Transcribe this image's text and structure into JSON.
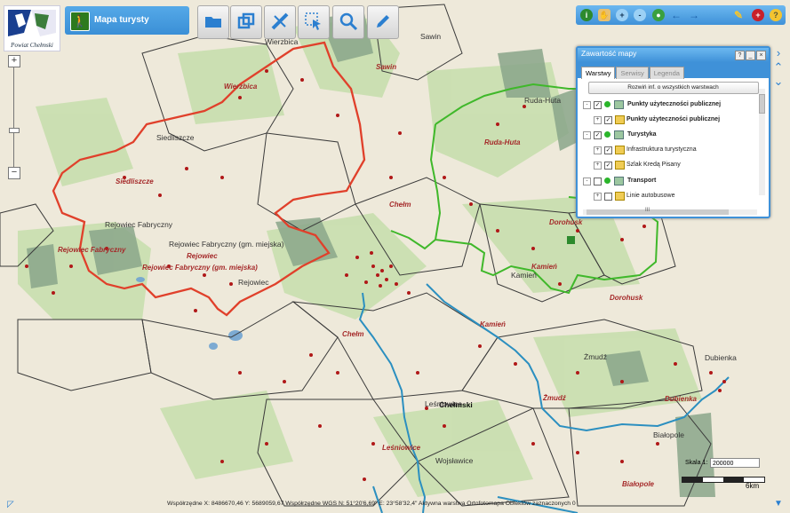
{
  "logo": {
    "text": "Powiat Chełmski"
  },
  "title": "Mapa turysty",
  "toolbar": {
    "icons": [
      "folder-icon",
      "windows-icon",
      "measure-icon",
      "select-icon",
      "search-icon",
      "edit-icon"
    ]
  },
  "right_toolbar": {
    "icons": [
      "info-icon",
      "hand-icon",
      "zoom-in-icon",
      "zoom-out-icon",
      "globe-icon",
      "back-icon",
      "forward-icon",
      "help-tools-icon",
      "flag-icon",
      "question-icon"
    ]
  },
  "panel": {
    "title": "Zawartość mapy",
    "tabs": [
      "Warstwy",
      "Serwisy",
      "Legenda"
    ],
    "active_tab": "Warstwy",
    "expand_button": "Rozwiń inf. o wszystkich warstwach",
    "layers": [
      {
        "label": "Punkty użyteczności publicznej",
        "level": 0,
        "bold": true
      },
      {
        "label": "Punkty użyteczności publicznej",
        "level": 1,
        "bold": true
      },
      {
        "label": "Turystyka",
        "level": 0,
        "bold": true
      },
      {
        "label": "Infrastruktura turystyczna",
        "level": 1,
        "bold": false
      },
      {
        "label": "Szlak Kredą Pisany",
        "level": 1,
        "bold": false
      },
      {
        "label": "Transport",
        "level": 0,
        "bold": true
      },
      {
        "label": "Linie autobusowe",
        "level": 1,
        "bold": false
      }
    ],
    "scroll_mark": "III"
  },
  "map": {
    "labels": {
      "red_italic": [
        "Wierzbica",
        "Sawin",
        "Siedliszcze",
        "Ruda-Huta",
        "Chełm",
        "Dorohusk",
        "Kamień",
        "Rejowiec Fabryczny",
        "Rejowiec",
        "Rejowiec Fabryczny (gm. miejska)",
        "Dorohusk",
        "Kamień",
        "Chełm",
        "Żmudź",
        "Dubienka",
        "Leśniowice",
        "Białopole"
      ],
      "gray": [
        "Wierzbica",
        "Sawin",
        "Siedliszcze",
        "Ruda-Huta",
        "Rejowiec Fabryczny",
        "Rejowiec Fabryczny (gm. miejska)",
        "Rejowiec",
        "Kamień",
        "Żmudź",
        "Dubienka",
        "Leśniowice",
        "Wojsławice",
        "Białopole"
      ],
      "black_bold": [
        "Chełmski"
      ]
    }
  },
  "scale": {
    "label": "Skala 1:",
    "value": "200000",
    "unit": "6km"
  },
  "status": {
    "text": "Współrzędne X: 8486670,46 Y: 5689059,67   Współrzędne WGS N: 51°20'6,69\" E: 23°58'32,4\"   Aktywna warstwa Ortofotomapa   Obiektów zaznaczonych 0"
  }
}
